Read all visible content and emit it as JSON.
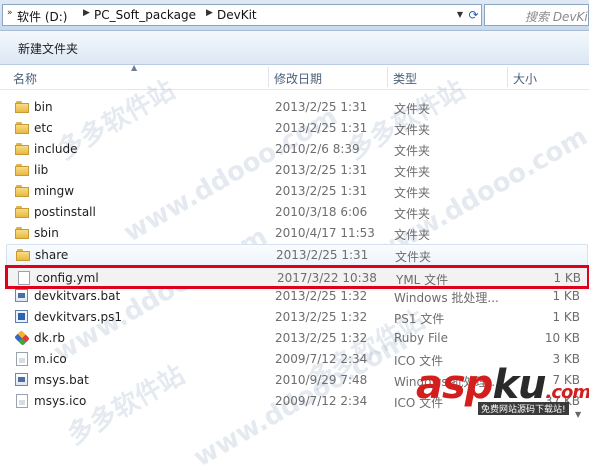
{
  "address": {
    "crumbs": [
      "软件 (D:)",
      "PC_Soft_package",
      "DevKit"
    ],
    "search_placeholder": "搜索 DevKit"
  },
  "toolbar": {
    "new_folder_label": "新建文件夹"
  },
  "columns": {
    "name": "名称",
    "date": "修改日期",
    "type": "类型",
    "size": "大小"
  },
  "files": [
    {
      "name": "bin",
      "date": "2013/2/25 1:31",
      "type": "文件夹",
      "size": "",
      "icon": "folder-icon"
    },
    {
      "name": "etc",
      "date": "2013/2/25 1:31",
      "type": "文件夹",
      "size": "",
      "icon": "folder-icon"
    },
    {
      "name": "include",
      "date": "2010/2/6 8:39",
      "type": "文件夹",
      "size": "",
      "icon": "folder-icon"
    },
    {
      "name": "lib",
      "date": "2013/2/25 1:31",
      "type": "文件夹",
      "size": "",
      "icon": "folder-icon"
    },
    {
      "name": "mingw",
      "date": "2013/2/25 1:31",
      "type": "文件夹",
      "size": "",
      "icon": "folder-icon"
    },
    {
      "name": "postinstall",
      "date": "2010/3/18 6:06",
      "type": "文件夹",
      "size": "",
      "icon": "folder-icon"
    },
    {
      "name": "sbin",
      "date": "2010/4/17 11:53",
      "type": "文件夹",
      "size": "",
      "icon": "folder-icon"
    },
    {
      "name": "share",
      "date": "2013/2/25 1:31",
      "type": "文件夹",
      "size": "",
      "icon": "folder-icon"
    },
    {
      "name": "config.yml",
      "date": "2017/3/22 10:38",
      "type": "YML 文件",
      "size": "1 KB",
      "icon": "document-icon"
    },
    {
      "name": "devkitvars.bat",
      "date": "2013/2/25 1:32",
      "type": "Windows 批处理...",
      "size": "1 KB",
      "icon": "batch-file-icon"
    },
    {
      "name": "devkitvars.ps1",
      "date": "2013/2/25 1:32",
      "type": "PS1 文件",
      "size": "1 KB",
      "icon": "powershell-file-icon"
    },
    {
      "name": "dk.rb",
      "date": "2013/2/25 1:32",
      "type": "Ruby File",
      "size": "10 KB",
      "icon": "ruby-file-icon"
    },
    {
      "name": "m.ico",
      "date": "2009/7/12 2:34",
      "type": "ICO 文件",
      "size": "3 KB",
      "icon": "ico-file-icon"
    },
    {
      "name": "msys.bat",
      "date": "2010/9/29 7:48",
      "type": "Windows 批处理...",
      "size": "7 KB",
      "icon": "batch-file-icon"
    },
    {
      "name": "msys.ico",
      "date": "2009/7/12 2:34",
      "type": "ICO 文件",
      "size": "37 KB",
      "icon": "ico-file-icon"
    }
  ],
  "watermark": {
    "text": "www.ddooo.com",
    "site_text": "多多软件站"
  },
  "logo": {
    "red_a": "asp",
    "black": "ku",
    "red_b": ".com",
    "subtitle": "免费网站源码下载站!"
  },
  "colors": {
    "selection_outline": "#e0001a",
    "folder": "#f0c558"
  }
}
